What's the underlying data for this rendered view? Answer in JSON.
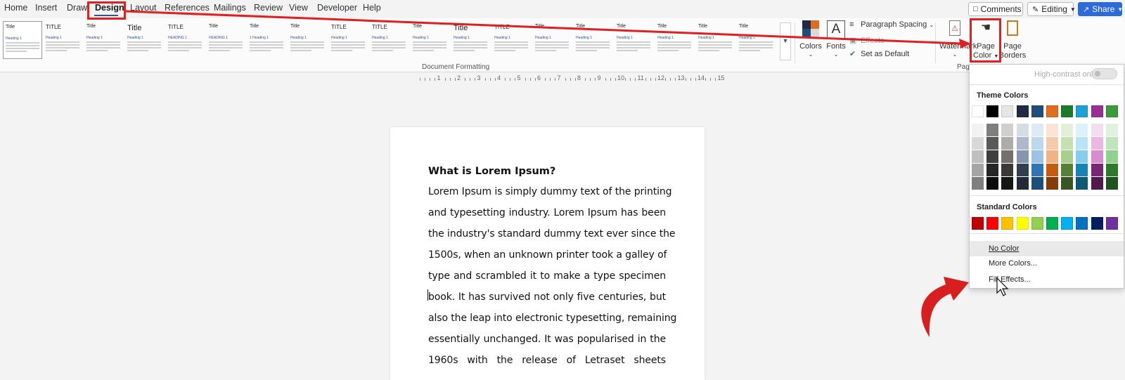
{
  "menu": {
    "tabs": [
      "Home",
      "Insert",
      "Draw",
      "Design",
      "Layout",
      "References",
      "Mailings",
      "Review",
      "View",
      "Developer",
      "Help"
    ],
    "active_tab": "Design"
  },
  "topbar": {
    "comments_label": "Comments",
    "editing_label": "Editing",
    "share_label": "Share"
  },
  "ribbon": {
    "gallery_samples": [
      {
        "title": "Title",
        "heading": "Heading 1"
      },
      {
        "title": "TITLE",
        "heading": "Heading 1"
      },
      {
        "title": "Title",
        "heading": "Heading 1"
      },
      {
        "title": "Title",
        "heading": "Heading 1"
      },
      {
        "title": "TITLE",
        "heading": "HEADING 1"
      },
      {
        "title": "Title",
        "heading": "HEADING 1"
      },
      {
        "title": "Title",
        "heading": "1 Heading 1"
      },
      {
        "title": "Title",
        "heading": "Heading 1"
      },
      {
        "title": "TITLE",
        "heading": "Heading 1"
      },
      {
        "title": "TITLE",
        "heading": "Heading 1"
      },
      {
        "title": "Title",
        "heading": "Heading 1"
      },
      {
        "title": "Title",
        "heading": "Heading 1"
      },
      {
        "title": "TITLE",
        "heading": "Heading 1"
      },
      {
        "title": "Title",
        "heading": "Heading 1"
      },
      {
        "title": "Title",
        "heading": "Heading 1"
      },
      {
        "title": "Title",
        "heading": "Heading 1"
      },
      {
        "title": "Title",
        "heading": "Heading 1"
      },
      {
        "title": "Title",
        "heading": "Heading 1"
      },
      {
        "title": "Title",
        "heading": "Heading 1"
      }
    ],
    "group_document_formatting": "Document Formatting",
    "colors_label": "Colors",
    "fonts_label": "Fonts",
    "fonts_icon_letter": "A",
    "paragraph_spacing_label": "Paragraph Spacing",
    "effects_label": "Effects",
    "set_as_default_label": "Set as Default",
    "watermark_label": "Watermark",
    "page_color_label_1": "Page",
    "page_color_label_2": "Color",
    "page_borders_label_1": "Page",
    "page_borders_label_2": "Borders",
    "group_page_background": "Page"
  },
  "ruler": {
    "numbers": [
      "1",
      "2",
      "3",
      "4",
      "5",
      "6",
      "7",
      "8",
      "9",
      "10",
      "11",
      "12",
      "13",
      "14",
      "15"
    ]
  },
  "document": {
    "heading": "What is Lorem Ipsum?",
    "lines": [
      "Lorem Ipsum is simply dummy text of the printing",
      "and typesetting industry. Lorem Ipsum has been",
      "the industry's standard dummy text ever since the",
      "1500s, when an unknown printer took a galley of",
      "type and scrambled it to make a type specimen",
      "book. It has survived not only five centuries, but",
      "also the leap into electronic typesetting, remaining",
      "essentially unchanged. It was popularised in the",
      "1960s with the release of Letraset sheets"
    ]
  },
  "page_color_menu": {
    "high_contrast_label": "High-contrast only",
    "theme_colors_label": "Theme Colors",
    "theme_top_row": [
      "#ffffff",
      "#000000",
      "#e7e6e6",
      "#1f2a44",
      "#1f4e79",
      "#e06c21",
      "#1e7a2b",
      "#1aa1d6",
      "#9c2f96",
      "#3a9b3a"
    ],
    "theme_shades": [
      [
        "#f2f2f2",
        "#7f7f7f",
        "#d0cece",
        "#d6dce4",
        "#deebf6",
        "#fbe4d5",
        "#e2efd9",
        "#ddf1fb",
        "#f4dcf1",
        "#dff2de"
      ],
      [
        "#d8d8d8",
        "#595959",
        "#aeabab",
        "#adb9ca",
        "#bdd7ee",
        "#f7caac",
        "#c5e0b3",
        "#b9e3f7",
        "#e9b9e3",
        "#bfe5bd"
      ],
      [
        "#bfbfbf",
        "#3f3f3f",
        "#757070",
        "#8496b0",
        "#9cc3e5",
        "#f4b183",
        "#a8d08d",
        "#86cdee",
        "#d98bcf",
        "#90d28d"
      ],
      [
        "#a5a5a5",
        "#262626",
        "#3a3838",
        "#323f4f",
        "#2e75b5",
        "#c55a11",
        "#538135",
        "#1784b5",
        "#7a2474",
        "#2d7a2d"
      ],
      [
        "#7f7f7f",
        "#0c0c0c",
        "#171616",
        "#222a35",
        "#1e4e79",
        "#843c0b",
        "#375623",
        "#0f5876",
        "#51184d",
        "#1e521e"
      ]
    ],
    "standard_colors_label": "Standard Colors",
    "standard_colors": [
      "#c00000",
      "#ff0000",
      "#ffc000",
      "#ffff00",
      "#92d050",
      "#00b050",
      "#00b0f0",
      "#0070c0",
      "#002060",
      "#7030a0"
    ],
    "no_color_label": "No Color",
    "more_colors_label": "More Colors...",
    "fill_effects_label": "Fill Effects..."
  },
  "colors": {
    "annotation_red": "#e02020",
    "share_blue": "#2b6ad8"
  }
}
